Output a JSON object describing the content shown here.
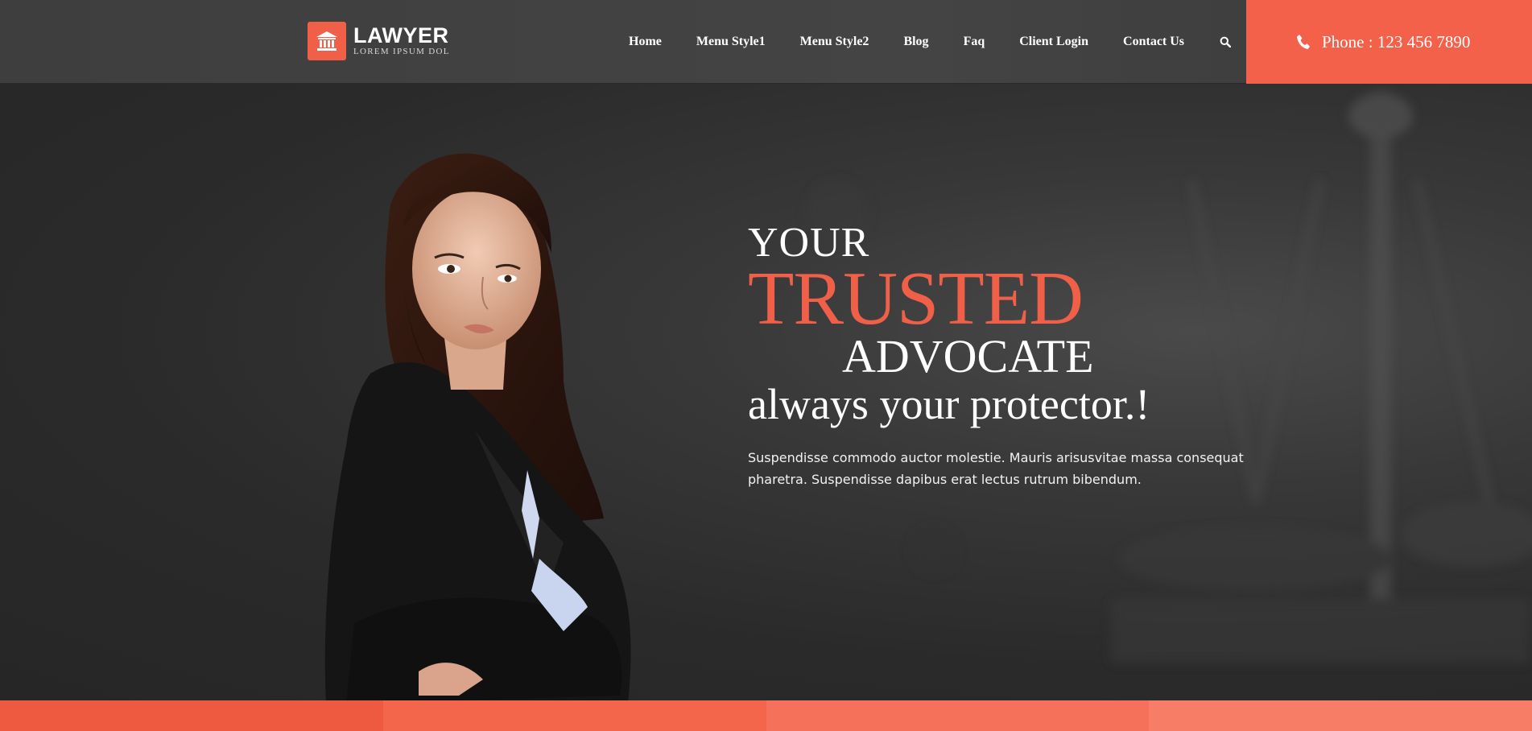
{
  "header": {
    "logo": {
      "title": "LAWYER",
      "subtitle": "LOREM IPSUM DOL",
      "icon": "courthouse-icon"
    },
    "nav": [
      {
        "label": "Home"
      },
      {
        "label": "Menu Style1"
      },
      {
        "label": "Menu Style2"
      },
      {
        "label": "Blog"
      },
      {
        "label": "Faq"
      },
      {
        "label": "Client Login"
      },
      {
        "label": "Contact Us"
      }
    ],
    "search_icon": "search-icon",
    "phone": {
      "text": "Phone : 123 456 7890",
      "icon": "phone-icon"
    }
  },
  "hero": {
    "line1": "YOUR",
    "line2": "TRUSTED",
    "line3": "ADVOCATE",
    "line4": "always your protector.!",
    "description": "Suspendisse commodo auctor molestie. Mauris arisusvitae massa consequat pharetra. Suspendisse dapibus erat lectus rutrum bibendum."
  },
  "colors": {
    "accent": "#f06048",
    "header_bg": "#424242",
    "hero_bg": "#2a2a2a",
    "stripe": [
      "#ee5a40",
      "#f3664c",
      "#f57159",
      "#f77d66"
    ]
  }
}
